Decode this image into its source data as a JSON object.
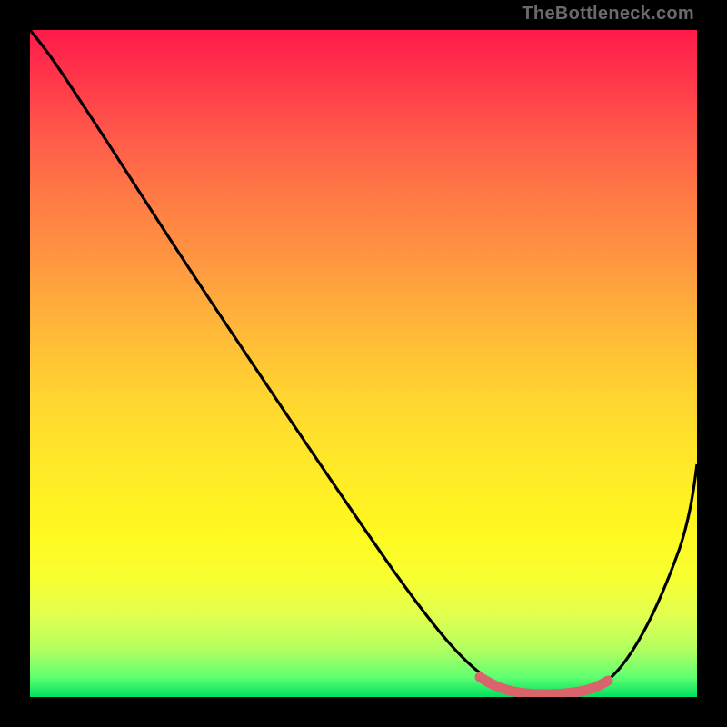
{
  "watermark": "TheBottleneck.com",
  "chart_data": {
    "type": "line",
    "title": "",
    "xlabel": "",
    "ylabel": "",
    "xlim": [
      0,
      100
    ],
    "ylim": [
      0,
      100
    ],
    "series": [
      {
        "name": "bottleneck-curve",
        "x": [
          0,
          5,
          10,
          20,
          30,
          40,
          50,
          60,
          65,
          70,
          75,
          80,
          85,
          90,
          95,
          100
        ],
        "values": [
          100,
          97,
          92,
          80,
          65,
          50,
          35,
          20,
          12,
          5,
          2,
          1,
          2,
          8,
          20,
          35
        ]
      },
      {
        "name": "optimal-highlight",
        "x": [
          68,
          72,
          76,
          80,
          84
        ],
        "values": [
          3,
          2,
          1,
          1,
          2
        ]
      }
    ],
    "colors": {
      "curve": "#000000",
      "highlight": "#d9646b",
      "gradient_top": "#ff1a4a",
      "gradient_bottom": "#00e060"
    }
  }
}
